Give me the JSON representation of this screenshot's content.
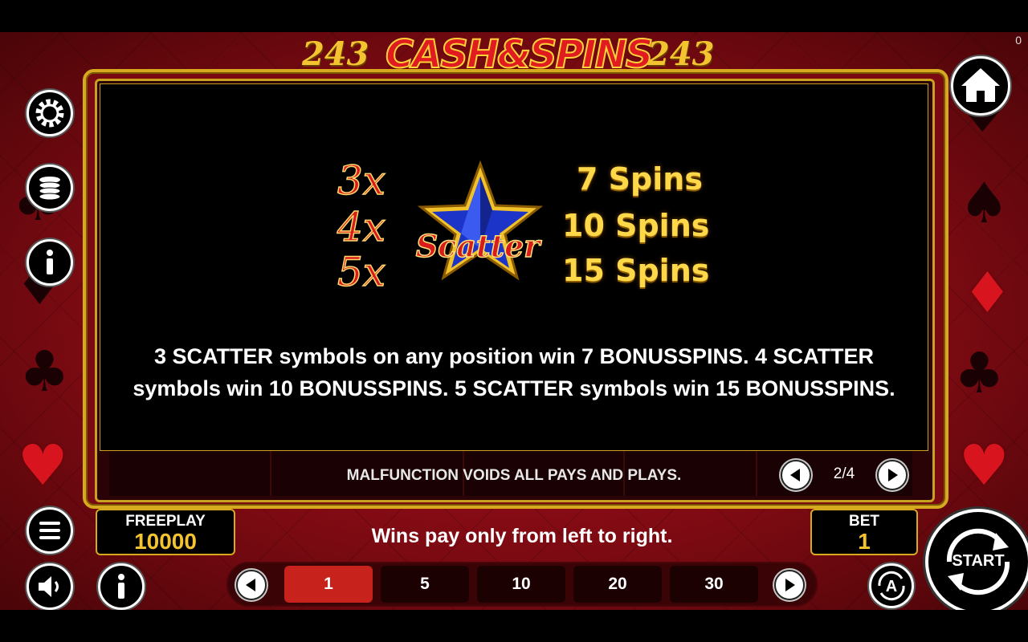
{
  "game": {
    "logo_left": "243",
    "logo_title": "CASH&SPINS",
    "logo_right": "243",
    "corner_counter": "0"
  },
  "paytable": {
    "rows": [
      {
        "multiplier": "3x",
        "spins": "7 Spins"
      },
      {
        "multiplier": "4x",
        "spins": "10 Spins"
      },
      {
        "multiplier": "5x",
        "spins": "15 Spins"
      }
    ],
    "symbol_label": "Scatter",
    "description": "3 SCATTER symbols on any position win 7 BONUSSPINS. 4 SCATTER symbols win 10 BONUSSPINS. 5 SCATTER symbols win 15 BONUSSPINS.",
    "disclaimer": "MALFUNCTION VOIDS ALL PAYS AND PLAYS.",
    "page_indicator": "2/4"
  },
  "freeplay": {
    "label": "FREEPLAY",
    "value": "10000"
  },
  "bet": {
    "label": "BET",
    "value": "1"
  },
  "wins_note": "Wins pay only from left to right.",
  "bet_options": [
    "1",
    "5",
    "10",
    "20",
    "30"
  ],
  "selected_bet": "1",
  "start_label": "START",
  "icons": {
    "left_menu": [
      "settings-gear-icon",
      "coin-stack-icon",
      "info-icon"
    ],
    "bottom_left": [
      "menu-icon",
      "sound-icon",
      "info-icon"
    ],
    "right": [
      "home-icon",
      "autoplay-icon",
      "start-arrows-icon"
    ]
  },
  "colors": {
    "felt": "#b0101a",
    "gold": "#d6a91f",
    "selected_bet": "#c8221c",
    "spins_text": "#ffd84a",
    "scatter_star": "#1c34c8"
  }
}
